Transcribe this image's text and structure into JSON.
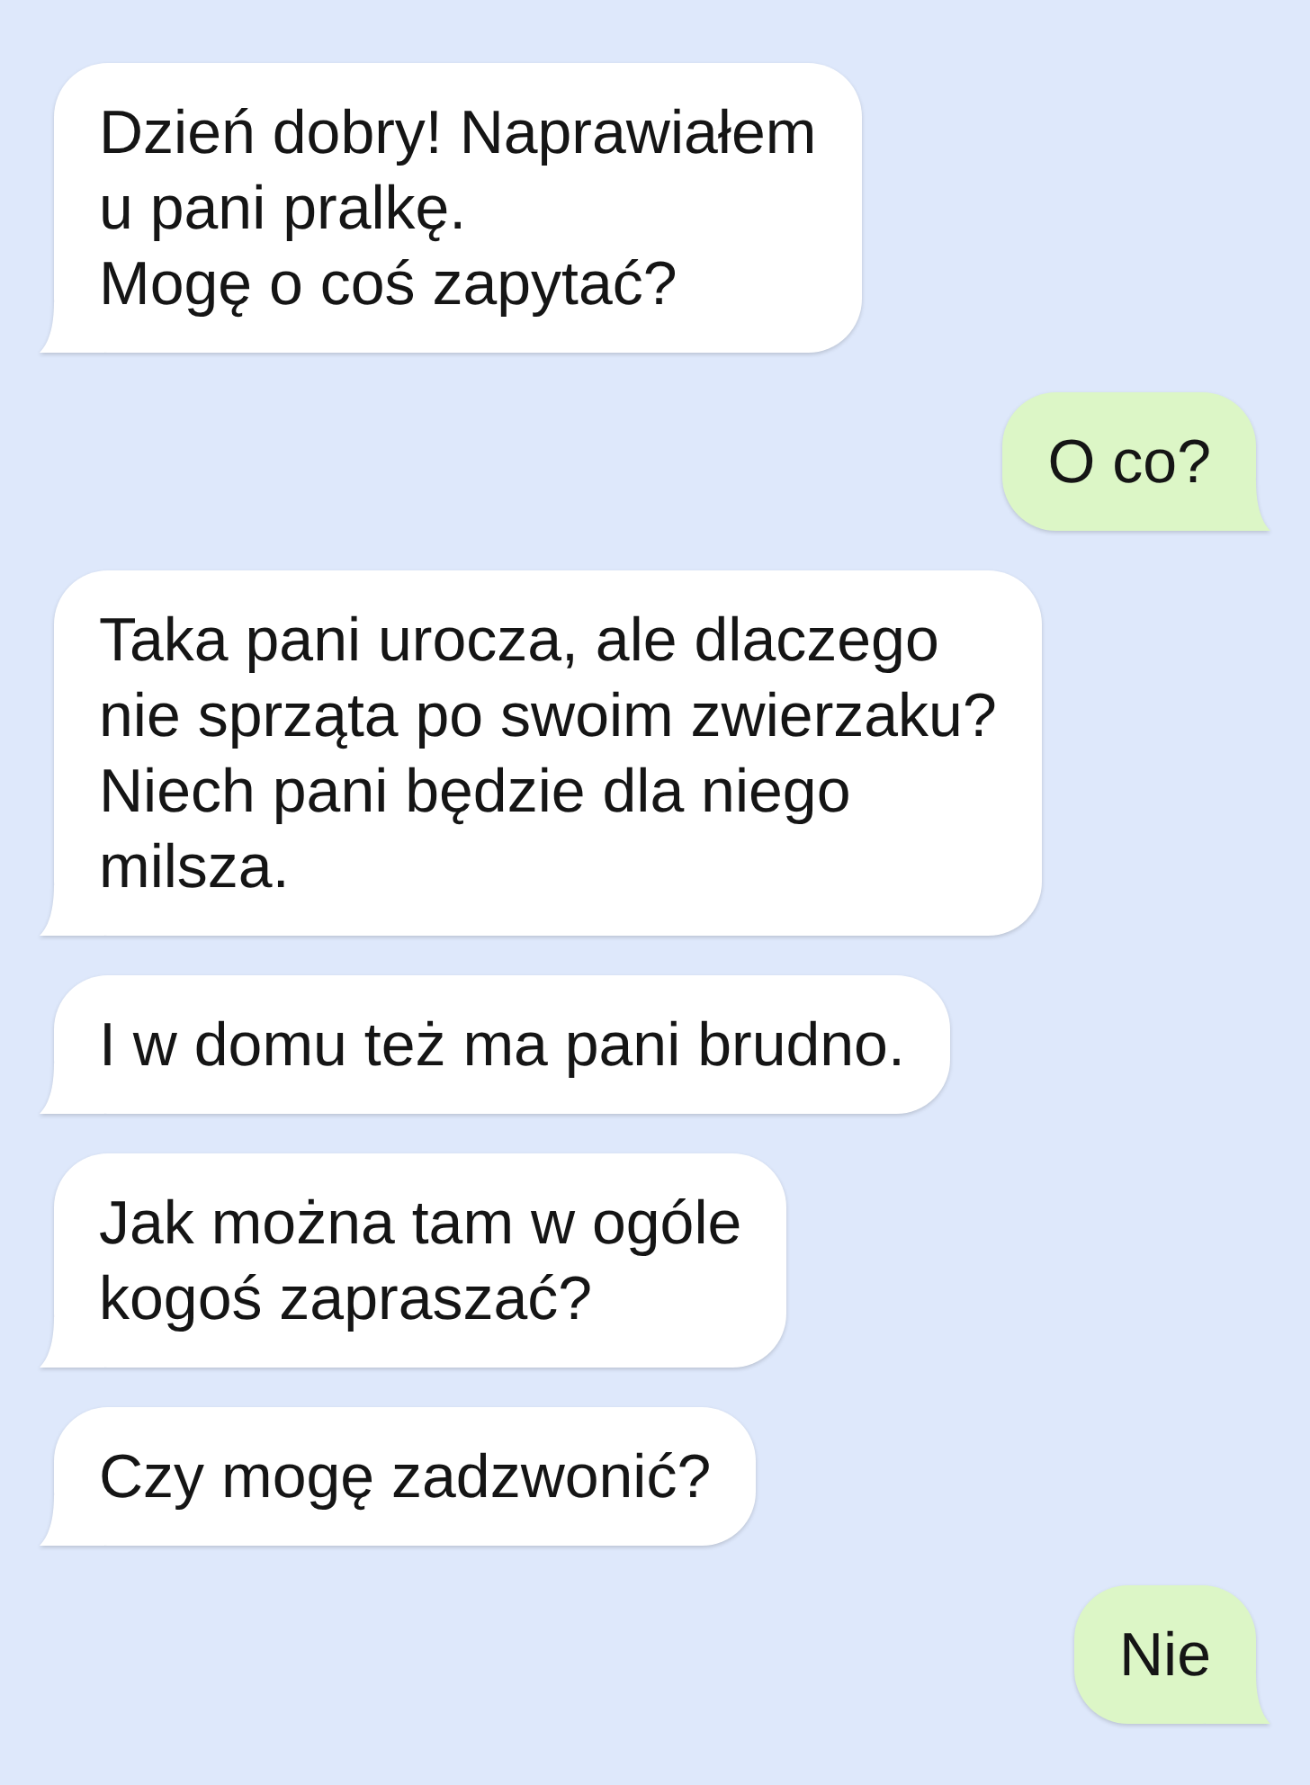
{
  "messages": [
    {
      "kind": "incoming",
      "text": "Dzień dobry! Naprawiałem\nu pani pralkę.\nMogę o coś zapytać?"
    },
    {
      "kind": "outgoing",
      "text": "O co?"
    },
    {
      "kind": "incoming",
      "text": "Taka pani urocza, ale dlaczego\nnie sprząta po swoim zwierzaku?\nNiech pani będzie dla niego\nmilsza."
    },
    {
      "kind": "incoming",
      "text": "I w domu też ma pani brudno."
    },
    {
      "kind": "incoming",
      "text": "Jak można tam w ogóle\nkogoś zapraszać?"
    },
    {
      "kind": "incoming",
      "text": "Czy mogę zadzwonić?"
    },
    {
      "kind": "outgoing",
      "text": "Nie"
    }
  ]
}
